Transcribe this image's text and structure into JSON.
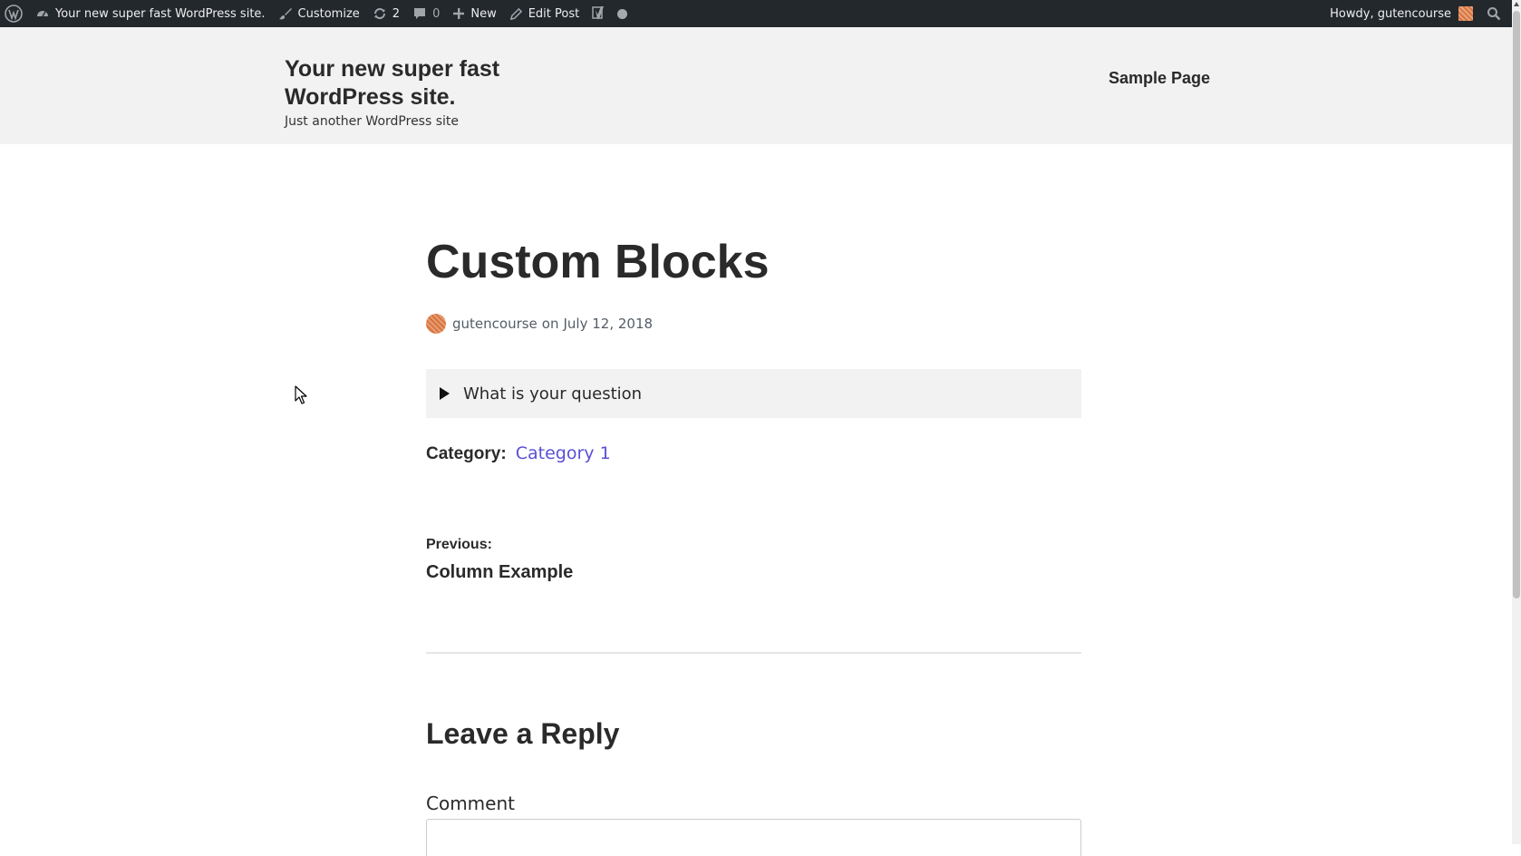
{
  "admin_bar": {
    "site_name": "Your new super fast WordPress site.",
    "customize_label": "Customize",
    "updates_count": "2",
    "comments_count": "0",
    "new_label": "New",
    "edit_post_label": "Edit Post",
    "howdy_label": "Howdy, gutencourse"
  },
  "site_header": {
    "title": "Your new super fast WordPress site.",
    "description": "Just another WordPress site",
    "nav": {
      "sample_page": "Sample Page"
    }
  },
  "post": {
    "title": "Custom Blocks",
    "author": "gutencourse",
    "meta_on": "on",
    "date": "July 12, 2018",
    "details_summary": "What is your question",
    "category_label": "Category:",
    "category_value": "Category 1",
    "previous_label": "Previous:",
    "previous_title": "Column Example"
  },
  "comments": {
    "reply_title": "Leave a Reply",
    "comment_label": "Comment"
  },
  "colors": {
    "admin_bar_bg": "#23282d",
    "header_bg": "#f2f2f2",
    "link": "#5b4fd6",
    "avatar": "#d9733b"
  }
}
